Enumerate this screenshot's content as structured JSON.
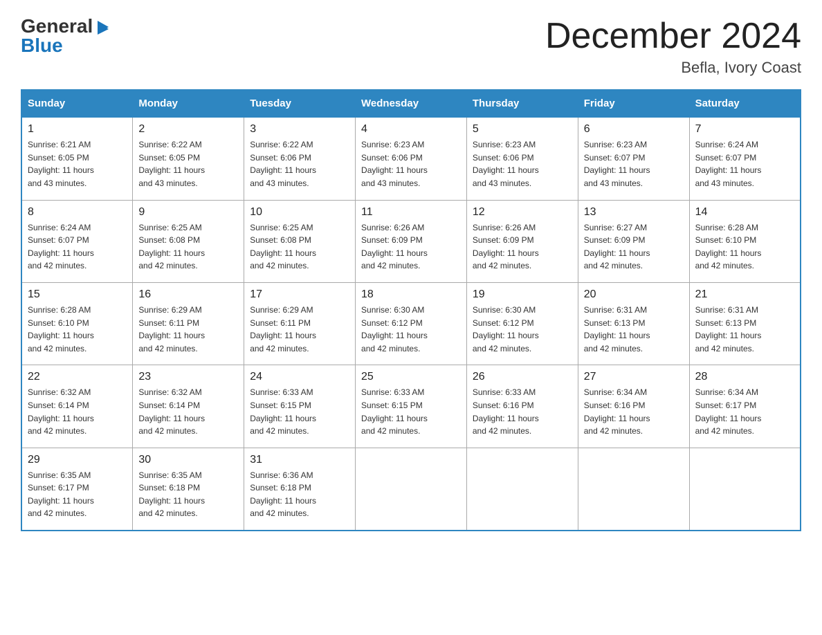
{
  "logo": {
    "general": "General",
    "blue": "Blue",
    "arrow": "▶"
  },
  "title": "December 2024",
  "location": "Befla, Ivory Coast",
  "days_of_week": [
    "Sunday",
    "Monday",
    "Tuesday",
    "Wednesday",
    "Thursday",
    "Friday",
    "Saturday"
  ],
  "weeks": [
    [
      {
        "day": "1",
        "info": "Sunrise: 6:21 AM\nSunset: 6:05 PM\nDaylight: 11 hours\nand 43 minutes."
      },
      {
        "day": "2",
        "info": "Sunrise: 6:22 AM\nSunset: 6:05 PM\nDaylight: 11 hours\nand 43 minutes."
      },
      {
        "day": "3",
        "info": "Sunrise: 6:22 AM\nSunset: 6:06 PM\nDaylight: 11 hours\nand 43 minutes."
      },
      {
        "day": "4",
        "info": "Sunrise: 6:23 AM\nSunset: 6:06 PM\nDaylight: 11 hours\nand 43 minutes."
      },
      {
        "day": "5",
        "info": "Sunrise: 6:23 AM\nSunset: 6:06 PM\nDaylight: 11 hours\nand 43 minutes."
      },
      {
        "day": "6",
        "info": "Sunrise: 6:23 AM\nSunset: 6:07 PM\nDaylight: 11 hours\nand 43 minutes."
      },
      {
        "day": "7",
        "info": "Sunrise: 6:24 AM\nSunset: 6:07 PM\nDaylight: 11 hours\nand 43 minutes."
      }
    ],
    [
      {
        "day": "8",
        "info": "Sunrise: 6:24 AM\nSunset: 6:07 PM\nDaylight: 11 hours\nand 42 minutes."
      },
      {
        "day": "9",
        "info": "Sunrise: 6:25 AM\nSunset: 6:08 PM\nDaylight: 11 hours\nand 42 minutes."
      },
      {
        "day": "10",
        "info": "Sunrise: 6:25 AM\nSunset: 6:08 PM\nDaylight: 11 hours\nand 42 minutes."
      },
      {
        "day": "11",
        "info": "Sunrise: 6:26 AM\nSunset: 6:09 PM\nDaylight: 11 hours\nand 42 minutes."
      },
      {
        "day": "12",
        "info": "Sunrise: 6:26 AM\nSunset: 6:09 PM\nDaylight: 11 hours\nand 42 minutes."
      },
      {
        "day": "13",
        "info": "Sunrise: 6:27 AM\nSunset: 6:09 PM\nDaylight: 11 hours\nand 42 minutes."
      },
      {
        "day": "14",
        "info": "Sunrise: 6:28 AM\nSunset: 6:10 PM\nDaylight: 11 hours\nand 42 minutes."
      }
    ],
    [
      {
        "day": "15",
        "info": "Sunrise: 6:28 AM\nSunset: 6:10 PM\nDaylight: 11 hours\nand 42 minutes."
      },
      {
        "day": "16",
        "info": "Sunrise: 6:29 AM\nSunset: 6:11 PM\nDaylight: 11 hours\nand 42 minutes."
      },
      {
        "day": "17",
        "info": "Sunrise: 6:29 AM\nSunset: 6:11 PM\nDaylight: 11 hours\nand 42 minutes."
      },
      {
        "day": "18",
        "info": "Sunrise: 6:30 AM\nSunset: 6:12 PM\nDaylight: 11 hours\nand 42 minutes."
      },
      {
        "day": "19",
        "info": "Sunrise: 6:30 AM\nSunset: 6:12 PM\nDaylight: 11 hours\nand 42 minutes."
      },
      {
        "day": "20",
        "info": "Sunrise: 6:31 AM\nSunset: 6:13 PM\nDaylight: 11 hours\nand 42 minutes."
      },
      {
        "day": "21",
        "info": "Sunrise: 6:31 AM\nSunset: 6:13 PM\nDaylight: 11 hours\nand 42 minutes."
      }
    ],
    [
      {
        "day": "22",
        "info": "Sunrise: 6:32 AM\nSunset: 6:14 PM\nDaylight: 11 hours\nand 42 minutes."
      },
      {
        "day": "23",
        "info": "Sunrise: 6:32 AM\nSunset: 6:14 PM\nDaylight: 11 hours\nand 42 minutes."
      },
      {
        "day": "24",
        "info": "Sunrise: 6:33 AM\nSunset: 6:15 PM\nDaylight: 11 hours\nand 42 minutes."
      },
      {
        "day": "25",
        "info": "Sunrise: 6:33 AM\nSunset: 6:15 PM\nDaylight: 11 hours\nand 42 minutes."
      },
      {
        "day": "26",
        "info": "Sunrise: 6:33 AM\nSunset: 6:16 PM\nDaylight: 11 hours\nand 42 minutes."
      },
      {
        "day": "27",
        "info": "Sunrise: 6:34 AM\nSunset: 6:16 PM\nDaylight: 11 hours\nand 42 minutes."
      },
      {
        "day": "28",
        "info": "Sunrise: 6:34 AM\nSunset: 6:17 PM\nDaylight: 11 hours\nand 42 minutes."
      }
    ],
    [
      {
        "day": "29",
        "info": "Sunrise: 6:35 AM\nSunset: 6:17 PM\nDaylight: 11 hours\nand 42 minutes."
      },
      {
        "day": "30",
        "info": "Sunrise: 6:35 AM\nSunset: 6:18 PM\nDaylight: 11 hours\nand 42 minutes."
      },
      {
        "day": "31",
        "info": "Sunrise: 6:36 AM\nSunset: 6:18 PM\nDaylight: 11 hours\nand 42 minutes."
      },
      {
        "day": "",
        "info": ""
      },
      {
        "day": "",
        "info": ""
      },
      {
        "day": "",
        "info": ""
      },
      {
        "day": "",
        "info": ""
      }
    ]
  ],
  "colors": {
    "header_bg": "#2e86c1",
    "header_text": "#ffffff",
    "border": "#aaaaaa",
    "accent": "#2e86c1"
  }
}
